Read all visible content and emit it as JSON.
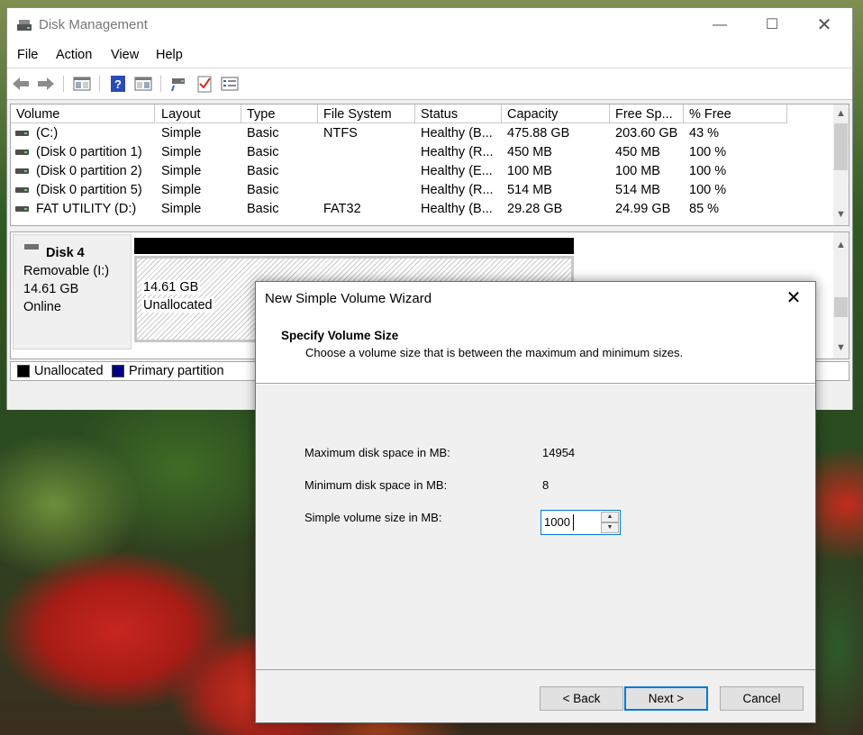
{
  "window": {
    "title": "Disk Management",
    "minimize_glyph": "—",
    "maximize_glyph": "☐",
    "close_glyph": "✕"
  },
  "menu": [
    "File",
    "Action",
    "View",
    "Help"
  ],
  "toolbar": {
    "icons": [
      "back-arrow-icon",
      "forward-arrow-icon",
      "console-tree-icon",
      "help-icon",
      "properties-icon",
      "connect-icon",
      "check-icon",
      "list-view-icon"
    ]
  },
  "volumes": {
    "headers": [
      "Volume",
      "Layout",
      "Type",
      "File System",
      "Status",
      "Capacity",
      "Free Sp...",
      "% Free"
    ],
    "rows": [
      [
        "(C:)",
        "Simple",
        "Basic",
        "NTFS",
        "Healthy (B...",
        "475.88 GB",
        "203.60 GB",
        "43 %"
      ],
      [
        "(Disk 0 partition 1)",
        "Simple",
        "Basic",
        "",
        "Healthy (R...",
        "450 MB",
        "450 MB",
        "100 %"
      ],
      [
        "(Disk 0 partition 2)",
        "Simple",
        "Basic",
        "",
        "Healthy (E...",
        "100 MB",
        "100 MB",
        "100 %"
      ],
      [
        "(Disk 0 partition 5)",
        "Simple",
        "Basic",
        "",
        "Healthy (R...",
        "514 MB",
        "514 MB",
        "100 %"
      ],
      [
        "FAT UTILITY (D:)",
        "Simple",
        "Basic",
        "FAT32",
        "Healthy (B...",
        "29.28 GB",
        "24.99 GB",
        "85 %"
      ]
    ]
  },
  "disk": {
    "name": "Disk 4",
    "type": "Removable (I:)",
    "size": "14.61 GB",
    "state": "Online",
    "partition_size": "14.61 GB",
    "partition_status": "Unallocated"
  },
  "legend": [
    {
      "label": "Unallocated",
      "color": "#000000"
    },
    {
      "label": "Primary partition",
      "color": "#000080"
    }
  ],
  "wizard": {
    "title": "New Simple Volume Wizard",
    "close_glyph": "✕",
    "heading": "Specify Volume Size",
    "subheading": "Choose a volume size that is between the maximum and minimum sizes.",
    "max_label": "Maximum disk space in MB:",
    "max_value": "14954",
    "min_label": "Minimum disk space in MB:",
    "min_value": "8",
    "size_label": "Simple volume size in MB:",
    "size_value": "1000",
    "back_label": "< Back",
    "next_label": "Next >",
    "cancel_label": "Cancel"
  }
}
